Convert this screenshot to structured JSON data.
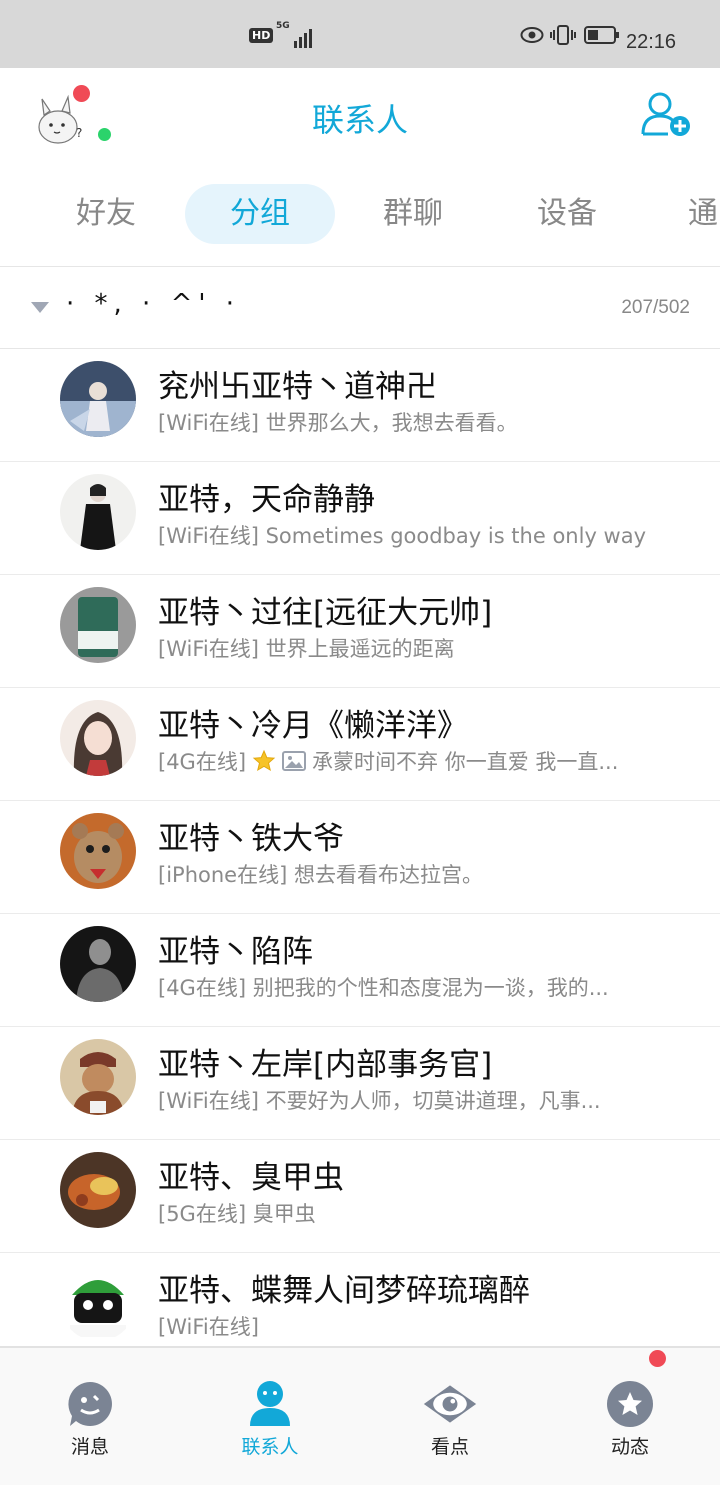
{
  "status_bar": {
    "hd_badge": "HD",
    "network": "5G",
    "time": "22:16"
  },
  "header": {
    "title": "联系人"
  },
  "tabs": [
    {
      "label": "好友",
      "active": false
    },
    {
      "label": "分组",
      "active": true
    },
    {
      "label": "群聊",
      "active": false
    },
    {
      "label": "设备",
      "active": false
    },
    {
      "label": "通",
      "active": false
    }
  ],
  "group": {
    "name": "· *, · ^' ·",
    "count": "207/502"
  },
  "contacts": [
    {
      "name": "兖州卐亚特丶道神卍",
      "status": "[WiFi在线] 世界那么大，我想去看看。",
      "has_icons": false
    },
    {
      "name": "亚特，天命静静",
      "status": "[WiFi在线] Sometimes goodbay is the only way",
      "has_icons": false
    },
    {
      "name": "亚特丶过往[远征大元帅]",
      "status": "[WiFi在线] 世界上最遥远的距离",
      "has_icons": false
    },
    {
      "name": "亚特丶冷月《懒洋洋》",
      "status_prefix": "[4G在线]",
      "status": "承蒙时间不弃 你一直爱 我一直...",
      "has_icons": true
    },
    {
      "name": "亚特丶铁大爷",
      "status": "[iPhone在线] 想去看看布达拉宫。",
      "has_icons": false
    },
    {
      "name": "亚特丶陷阵",
      "status": "[4G在线] 别把我的个性和态度混为一谈，我的...",
      "has_icons": false
    },
    {
      "name": "亚特丶左岸[内部事务官]",
      "status": "[WiFi在线] 不要好为人师，切莫讲道理，凡事...",
      "has_icons": false
    },
    {
      "name": "亚特、臭甲虫",
      "status": "[5G在线] 臭甲虫",
      "has_icons": false
    },
    {
      "name": "亚特、蝶舞人间梦碎琉璃醉",
      "status": "[WiFi在线]",
      "has_icons": false
    }
  ],
  "bottom_nav": [
    {
      "label": "消息",
      "icon": "message-icon",
      "active": false
    },
    {
      "label": "联系人",
      "icon": "contacts-icon",
      "active": true
    },
    {
      "label": "看点",
      "icon": "eye-icon",
      "active": false
    },
    {
      "label": "动态",
      "icon": "star-icon",
      "active": false,
      "badge": true
    }
  ],
  "colors": {
    "accent": "#12a8d8",
    "tab_active_bg": "#e5f4fc",
    "badge_red": "#f04a56",
    "online_green": "#2bd36b",
    "nav_icon_gray": "#7b8494"
  }
}
